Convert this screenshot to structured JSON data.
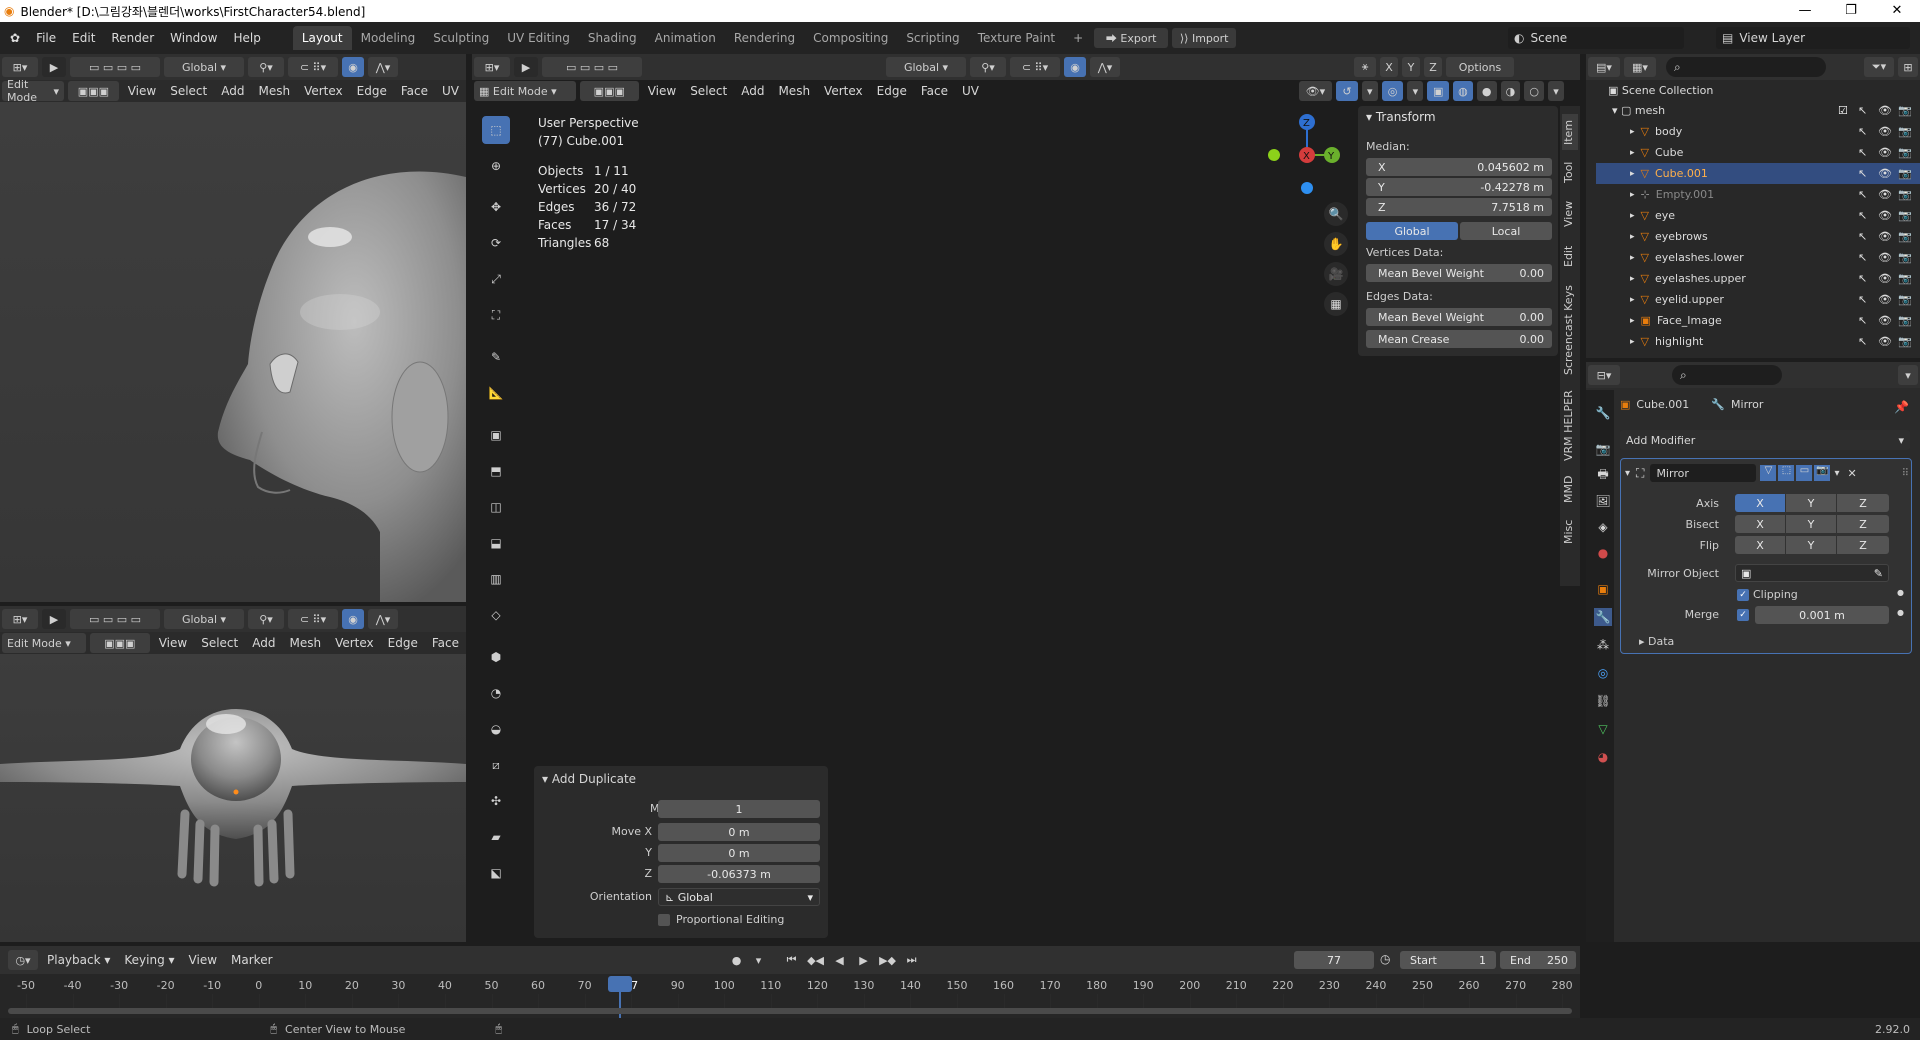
{
  "window": {
    "title": "Blender* [D:\\그림강좌\\블렌더\\works\\FirstCharacter54.blend]"
  },
  "menu": [
    "File",
    "Edit",
    "Render",
    "Window",
    "Help"
  ],
  "workspaces": [
    "Layout",
    "Modeling",
    "Sculpting",
    "UV Editing",
    "Shading",
    "Animation",
    "Rendering",
    "Compositing",
    "Scripting",
    "Texture Paint"
  ],
  "add_tab": "+",
  "export_label": "Export",
  "import_label": "Import",
  "scene": "Scene",
  "view_layer": "View Layer",
  "left_top": {
    "transform": "Global",
    "mode": "Edit Mode",
    "menus": [
      "View",
      "Select",
      "Add",
      "Mesh",
      "Vertex",
      "Edge",
      "Face",
      "UV"
    ]
  },
  "left_bottom": {
    "transform": "Global",
    "mode": "Edit Mode",
    "menus": [
      "View",
      "Select",
      "Add",
      "Mesh",
      "Vertex",
      "Edge",
      "Face"
    ]
  },
  "main_vp": {
    "transform": "Global",
    "mode": "Edit Mode",
    "menus": [
      "View",
      "Select",
      "Add",
      "Mesh",
      "Vertex",
      "Edge",
      "Face",
      "UV"
    ],
    "options": "Options",
    "axes": [
      "X",
      "Y",
      "Z"
    ],
    "perspective": "User Perspective",
    "object": "(77) Cube.001",
    "stats": [
      {
        "label": "Objects",
        "value": "1 / 11"
      },
      {
        "label": "Vertices",
        "value": "20 / 40"
      },
      {
        "label": "Edges",
        "value": "36 / 72"
      },
      {
        "label": "Faces",
        "value": "17 / 34"
      },
      {
        "label": "Triangles",
        "value": "68"
      }
    ],
    "gizmo": {
      "x": "X",
      "y": "Y",
      "z": "Z"
    }
  },
  "transform_panel": {
    "header": "Transform",
    "median": "Median:",
    "x_label": "X",
    "x": "0.045602 m",
    "y_label": "Y",
    "y": "-0.42278 m",
    "z_label": "Z",
    "z": "7.7518 m",
    "global": "Global",
    "local": "Local",
    "vdata": "Vertices Data:",
    "vbevel": "Mean Bevel Weight",
    "vbevel_val": "0.00",
    "edata": "Edges Data:",
    "ebevel": "Mean Bevel Weight",
    "ebevel_val": "0.00",
    "crease": "Mean Crease",
    "crease_val": "0.00"
  },
  "side_tabs": [
    "Item",
    "Tool",
    "View",
    "Edit",
    "Screencast Keys",
    "VRM HELPER",
    "MMD",
    "Misc"
  ],
  "add_duplicate": {
    "header": "Add Duplicate",
    "mode_label": "Mode",
    "mode": "1",
    "movex_label": "Move X",
    "movex": "0 m",
    "y_label": "Y",
    "y": "0 m",
    "z_label": "Z",
    "z": "-0.06373 m",
    "orient_label": "Orientation",
    "orient": "Global",
    "prop_edit": "Proportional Editing"
  },
  "outliner": {
    "scene_collection": "Scene Collection",
    "collection": "mesh",
    "items": [
      "body",
      "Cube",
      "Cube.001",
      "Empty.001",
      "eye",
      "eyebrows",
      "eyelashes.lower",
      "eyelashes.upper",
      "eyelid.upper",
      "Face_Image",
      "highlight"
    ]
  },
  "properties": {
    "object": "Cube.001",
    "modifier_tab": "Mirror",
    "add_modifier": "Add Modifier",
    "modifier_name": "Mirror",
    "axis_label": "Axis",
    "bisect_label": "Bisect",
    "flip_label": "Flip",
    "x": "X",
    "y": "Y",
    "z": "Z",
    "mirror_object": "Mirror Object",
    "clipping": "Clipping",
    "merge": "Merge",
    "merge_val": "0.001 m",
    "data": "Data"
  },
  "timeline": {
    "playback": "Playback",
    "keying": "Keying",
    "view": "View",
    "marker": "Marker",
    "current_frame": "77",
    "start_label": "Start",
    "start": "1",
    "end_label": "End",
    "end": "250",
    "ticks": [
      "-50",
      "-40",
      "-30",
      "-20",
      "-10",
      "0",
      "10",
      "20",
      "30",
      "40",
      "50",
      "60",
      "70",
      "77",
      "90",
      "100",
      "110",
      "120",
      "130",
      "140",
      "150",
      "160",
      "170",
      "180",
      "190",
      "200",
      "210",
      "220",
      "230",
      "240",
      "250",
      "260",
      "270",
      "280"
    ]
  },
  "status": {
    "left": "Loop Select",
    "middle": "Center View to Mouse",
    "version": "2.92.0"
  },
  "colors": {
    "accent": "#4772b3",
    "selection_orange": "#ff8c1a",
    "outliner_select": "#334d80",
    "modifier_blue": "#3d5a8c"
  }
}
